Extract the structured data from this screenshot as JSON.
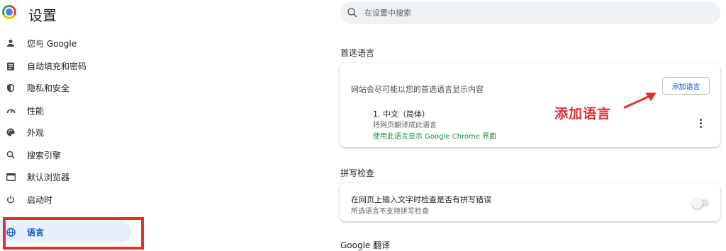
{
  "app": {
    "title": "设置"
  },
  "search": {
    "placeholder": "在设置中搜索"
  },
  "sidebar": {
    "items": [
      {
        "label": "您与 Google",
        "icon": "person-icon"
      },
      {
        "label": "自动填充和密码",
        "icon": "clipboard-icon"
      },
      {
        "label": "隐私和安全",
        "icon": "shield-icon"
      },
      {
        "label": "性能",
        "icon": "speedometer-icon"
      },
      {
        "label": "外观",
        "icon": "palette-icon"
      },
      {
        "label": "搜索引擎",
        "icon": "search-icon"
      },
      {
        "label": "默认浏览器",
        "icon": "browser-icon"
      },
      {
        "label": "启动时",
        "icon": "power-icon"
      },
      {
        "label": "语言",
        "icon": "globe-icon",
        "active": true
      }
    ]
  },
  "languages": {
    "section_title": "首选语言",
    "description": "网站会尽可能以您的首选语言显示内容",
    "add_button": "添加语言",
    "list": [
      {
        "name": "1. 中文（简体）",
        "sub1": "将网页翻译成此语言",
        "sub2": "使用此语言显示 Google Chrome 界面"
      }
    ]
  },
  "annotation": {
    "text": "添加语言",
    "color": "#e03131"
  },
  "spellcheck": {
    "section_title": "拼写检查",
    "main": "在网页上输入文字时检查是否有拼写错误",
    "sub": "所选语言不支持拼写检查",
    "enabled": false
  },
  "translate": {
    "section_title": "Google 翻译"
  },
  "colors": {
    "accent": "#0b57d0",
    "active_bg": "#e8f0fe",
    "annotation_red": "#e03131",
    "green_text": "#1e8e3e"
  }
}
